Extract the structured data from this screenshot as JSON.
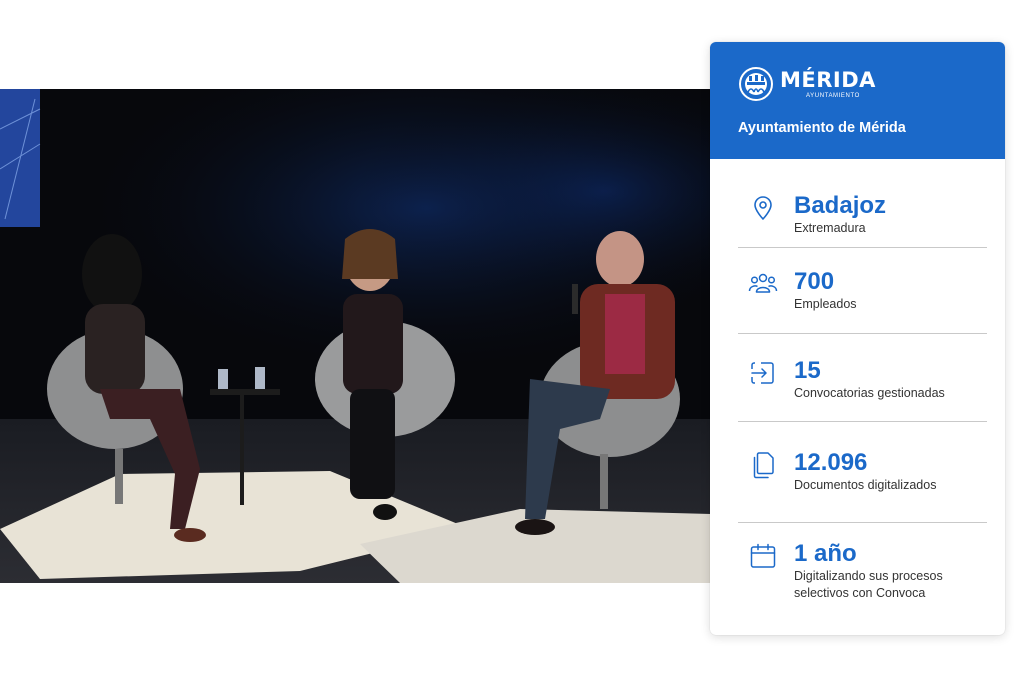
{
  "photo": {
    "subject": "stage-discussion-photo"
  },
  "card": {
    "logo": {
      "name": "MÉRIDA",
      "sub": "AYUNTAMIENTO",
      "icon": "merida-logo-mark"
    },
    "title": "Ayuntamiento de Mérida",
    "stats": [
      {
        "icon": "location-pin-icon",
        "value": "Badajoz",
        "label": "Extremadura"
      },
      {
        "icon": "users-group-icon",
        "value": "700",
        "label": "Empleados"
      },
      {
        "icon": "login-arrow-icon",
        "value": "15",
        "label": "Convocatorias gestionadas"
      },
      {
        "icon": "documents-icon",
        "value": "12.096",
        "label": "Documentos digitalizados"
      },
      {
        "icon": "calendar-icon",
        "value": "1 año",
        "label": "Digitalizando sus procesos selectivos con Convoca"
      }
    ]
  },
  "colors": {
    "accent": "#1b69c9",
    "divider": "#c9c9c9",
    "text": "#333333"
  }
}
